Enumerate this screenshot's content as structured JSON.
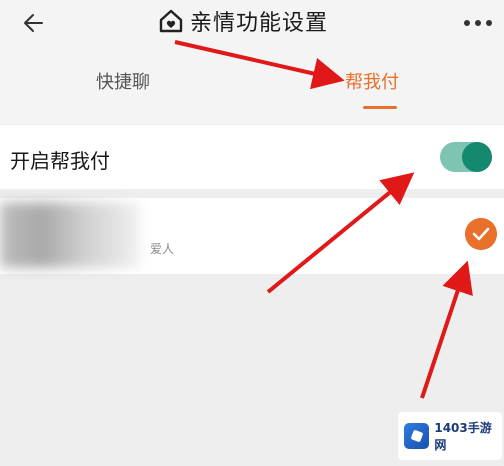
{
  "header": {
    "title": "亲情功能设置",
    "back_icon": "back-arrow-icon",
    "more_icon": "more-dots-icon",
    "home_icon": "home-heart-icon"
  },
  "tabs": [
    {
      "label": "快捷聊",
      "active": false
    },
    {
      "label": "帮我付",
      "active": true
    }
  ],
  "settings": {
    "toggle_label": "开启帮我付",
    "toggle_on": true
  },
  "contact": {
    "relation": "爱人",
    "selected": true
  },
  "watermark": {
    "text": "1403手游网"
  },
  "colors": {
    "accent_orange": "#e8702a",
    "toggle_green": "#138a6e",
    "arrow_red": "#e01818"
  }
}
